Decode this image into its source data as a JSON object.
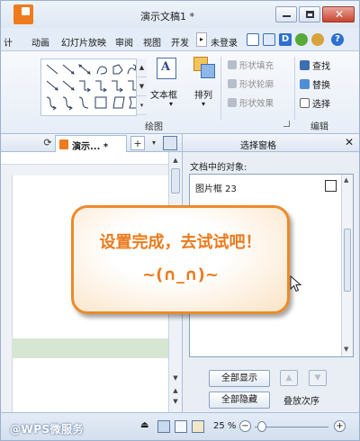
{
  "window": {
    "title": "演示文稿1 *",
    "close_glyph": "✕"
  },
  "menu": {
    "tabs": [
      "计",
      "动画",
      "幻灯片放映",
      "审阅",
      "视图",
      "开发"
    ],
    "overflow_glyph": "▸",
    "login_label": "未登录",
    "help_glyph": "?"
  },
  "ribbon": {
    "textbox_label": "文本框",
    "textbox_glyph": "A",
    "arrange_label": "排列",
    "shape_fill": "形状填充",
    "shape_outline": "形状轮廓",
    "shape_effect": "形状效果",
    "find": "查找",
    "replace": "替换",
    "select": "选择",
    "group_drawing": "绘图",
    "group_edit": "编辑",
    "dropdown_glyph": "▾"
  },
  "doc_tabs": {
    "active_tab": "演示... *",
    "add_glyph": "+",
    "refresh_glyph": "⟳"
  },
  "selection_pane": {
    "title": "选择窗格",
    "close_glyph": "✕",
    "objects_label": "文档中的对象:",
    "objects": [
      {
        "name": "图片框 23",
        "visible": false
      }
    ],
    "show_all": "全部显示",
    "hide_all": "全部隐藏",
    "order_label": "叠放次序",
    "up_glyph": "▲",
    "down_glyph": "▼"
  },
  "callout": {
    "line1": "设置完成，去试试吧！",
    "line2": "~(∩_∩)~"
  },
  "statusbar": {
    "watermark": "@WPS微服务",
    "zoom": "25 %",
    "zoom_level": 25,
    "zoom_out": "−",
    "zoom_in": "+"
  },
  "colors": {
    "accent_orange": "#ec8a2a",
    "ribbon_blue": "#dfe8f4",
    "close_red": "#c9432f"
  },
  "icons": [
    "wps-logo-icon",
    "minimize-icon",
    "maximize-icon",
    "close-icon",
    "shape-gallery-icons",
    "textbox-icon",
    "arrange-icon",
    "paint-bucket-icon",
    "pen-outline-icon",
    "effect-icon",
    "binoculars-icon",
    "replace-icon",
    "cursor-select-icon",
    "mouse-pointer-icon"
  ]
}
